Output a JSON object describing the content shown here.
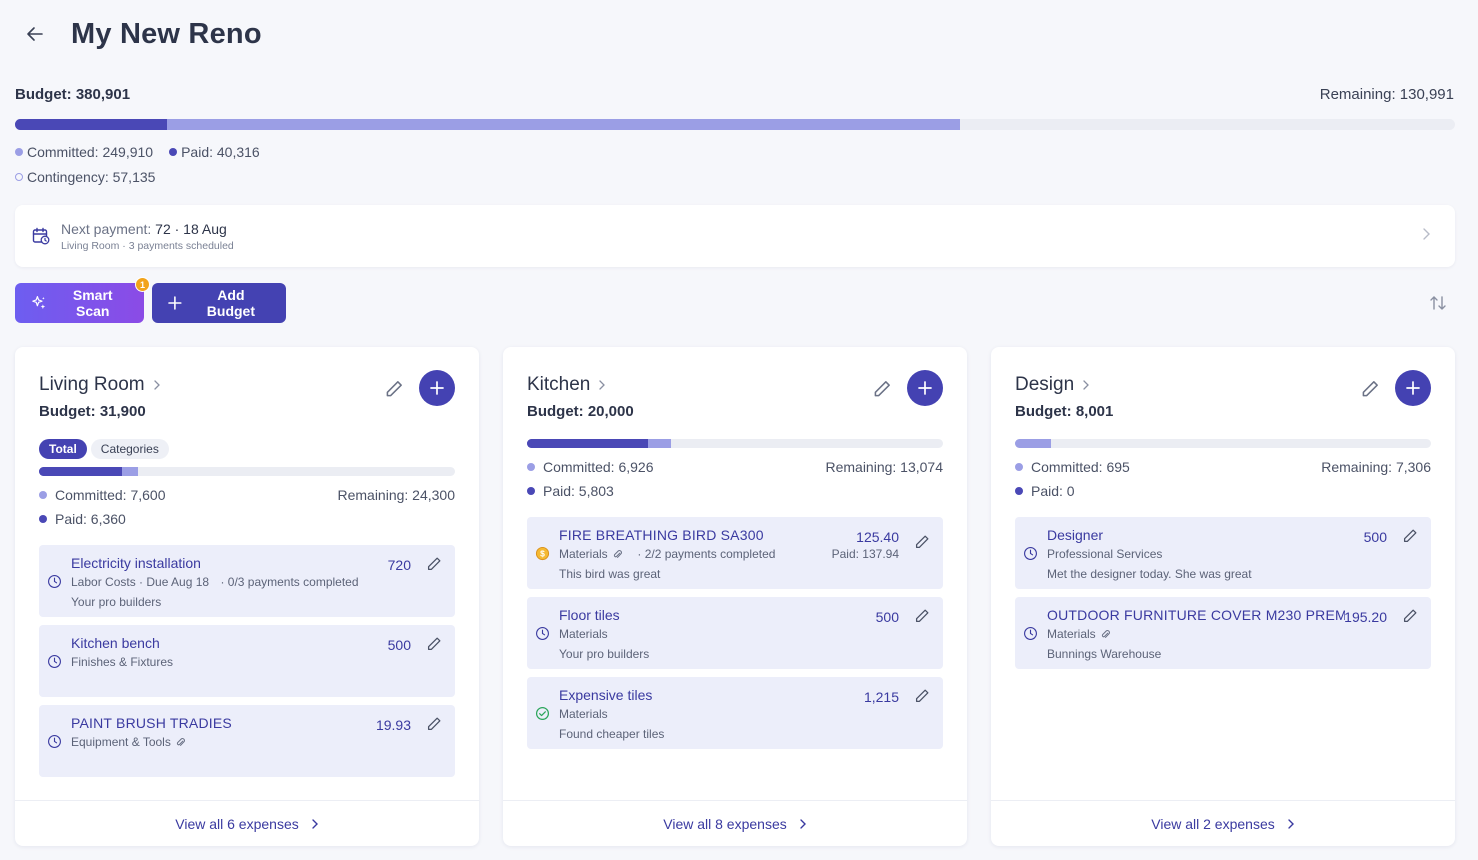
{
  "header": {
    "title": "My New Reno"
  },
  "summary": {
    "budget_label": "Budget: 380,901",
    "remaining_label": "Remaining: 130,991",
    "committed_label": "Committed: 249,910",
    "paid_label": "Paid: 40,316",
    "contingency_label": "Contingency: 57,135",
    "paid_fraction": 0.1058,
    "committed_fraction": 0.6561
  },
  "next_payment": {
    "label": "Next payment:",
    "value": "72 · 18 Aug",
    "sub": "Living Room · 3 payments scheduled"
  },
  "actions": {
    "smart_scan": "Smart Scan",
    "smart_scan_badge": "1",
    "add_budget": "Add Budget"
  },
  "colors": {
    "accent": "#4442b2",
    "committed": "#9b9ee5",
    "paid": "#4a48b6",
    "badge": "#f2a31a"
  },
  "cards": [
    {
      "title": "Living Room",
      "budget": "Budget: 31,900",
      "tabs": [
        "Total",
        "Categories"
      ],
      "committed": "Committed: 7,600",
      "remaining": "Remaining: 24,300",
      "paid": "Paid: 6,360",
      "paid_fraction": 0.1994,
      "committed_fraction": 0.2382,
      "expenses": [
        {
          "name": "Electricity installation",
          "sub": "Labor Costs · Due Aug 18",
          "sub2": "· 0/3 payments completed",
          "note": "Your pro builders",
          "amount": "720",
          "status_icon": "clock-icon"
        },
        {
          "name": "Kitchen bench",
          "sub": "Finishes & Fixtures",
          "note": "",
          "amount": "500",
          "status_icon": "clock-icon"
        },
        {
          "name": "PAINT BRUSH TRADIES",
          "sub": "Equipment & Tools",
          "note": "",
          "amount": "19.93",
          "status_icon": "clock-icon"
        }
      ],
      "footer": "View all 6 expenses"
    },
    {
      "title": "Kitchen",
      "budget": "Budget: 20,000",
      "committed": "Committed: 6,926",
      "remaining": "Remaining: 13,074",
      "paid": "Paid: 5,803",
      "paid_fraction": 0.2902,
      "committed_fraction": 0.3463,
      "expenses": [
        {
          "name": "FIRE BREATHING BIRD SA300",
          "sub": "Materials",
          "sub2": "· 2/2 payments completed",
          "note": "This bird was great",
          "amount": "125.40",
          "paid": "Paid: 137.94",
          "status_icon": "dollar-coin-icon"
        },
        {
          "name": "Floor tiles",
          "sub": "Materials",
          "note": "Your pro builders",
          "amount": "500",
          "status_icon": "clock-icon"
        },
        {
          "name": "Expensive tiles",
          "sub": "Materials",
          "note": "Found cheaper tiles",
          "amount": "1,215",
          "status_icon": "check-circle-icon"
        }
      ],
      "footer": "View all 8 expenses"
    },
    {
      "title": "Design",
      "budget": "Budget: 8,001",
      "committed": "Committed: 695",
      "remaining": "Remaining: 7,306",
      "paid": "Paid: 0",
      "paid_fraction": 0,
      "committed_fraction": 0.0869,
      "expenses": [
        {
          "name": "Designer",
          "sub": "Professional Services",
          "note": "Met the designer today. She was great",
          "amount": "500",
          "status_icon": "clock-icon"
        },
        {
          "name": "OUTDOOR FURNITURE COVER M230 PREM S...",
          "sub": "Materials",
          "note": "Bunnings Warehouse",
          "amount": "195.20",
          "status_icon": "clock-icon"
        }
      ],
      "footer": "View all 2 expenses"
    }
  ]
}
